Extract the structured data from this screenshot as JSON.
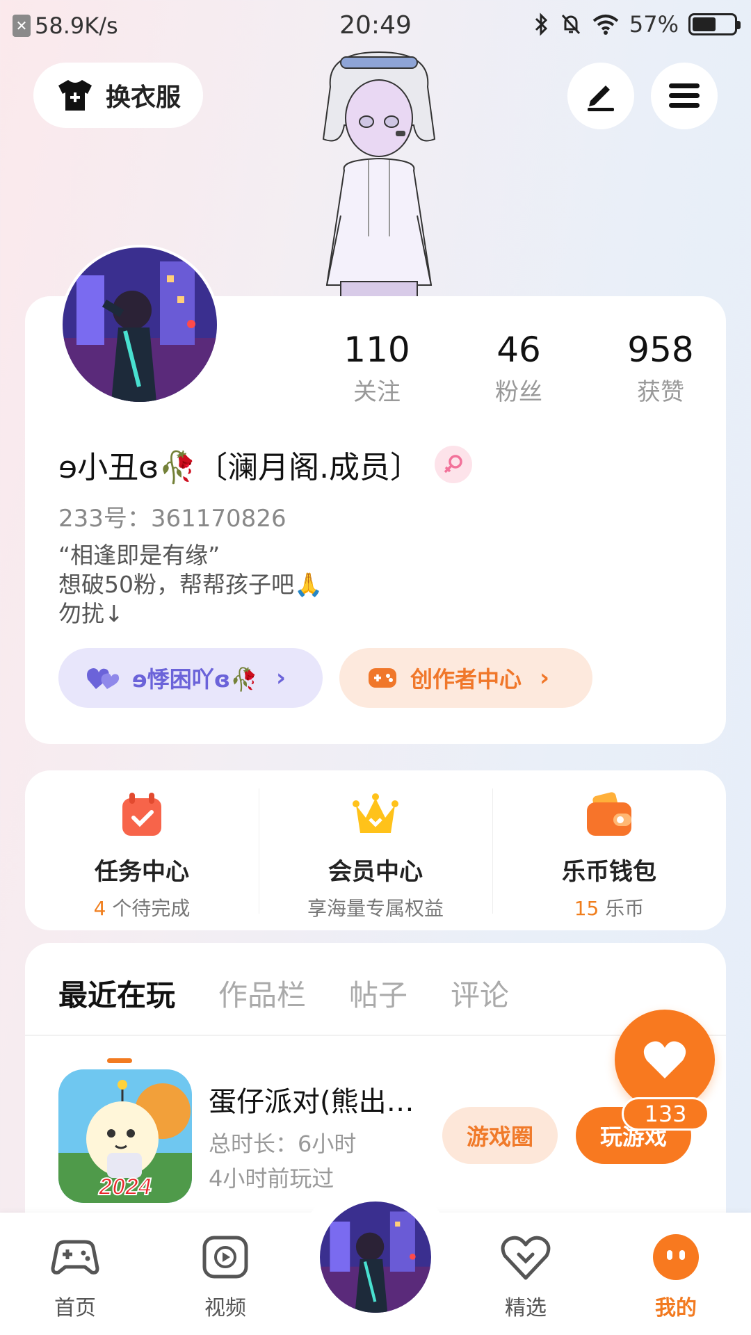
{
  "status_bar": {
    "net_speed": "58.9K/s",
    "time": "20:49",
    "battery_pct": "57%",
    "battery_level": 0.57
  },
  "top": {
    "dress_label": "换衣服"
  },
  "profile": {
    "stats": [
      {
        "num": "110",
        "label": "关注"
      },
      {
        "num": "46",
        "label": "粉丝"
      },
      {
        "num": "958",
        "label": "获赞"
      }
    ],
    "nickname": "ɘ小丑ɞ🥀〔澜月阁.成员〕",
    "uid": "233号：361170826",
    "bio": "“相逢即是有缘”\n想破50粉，帮帮孩子吧🙏\n勿扰↓",
    "guild_chip": "ɘ悸困吖ɞ🥀",
    "creator_chip": "创作者中心"
  },
  "services": [
    {
      "title": "任务中心",
      "sub_hl": "4",
      "sub": " 个待完成"
    },
    {
      "title": "会员中心",
      "sub_hl": "",
      "sub": "享海量专属权益"
    },
    {
      "title": "乐币钱包",
      "sub_hl": "15",
      "sub": " 乐币"
    }
  ],
  "tabs": [
    "最近在玩",
    "作品栏",
    "帖子",
    "评论"
  ],
  "recent_game": {
    "title": "蛋仔派对(熊出…",
    "duration": "总时长：6小时",
    "last_played": "4小时前玩过",
    "circle_btn": "游戏圈",
    "play_btn": "玩游戏",
    "badge": "2024"
  },
  "like_count": "133",
  "nav": [
    {
      "label": "首页"
    },
    {
      "label": "视频"
    },
    {
      "label": "精选"
    },
    {
      "label": "我的"
    }
  ],
  "colors": {
    "accent": "#f27a20",
    "guild": "#6b63d9"
  }
}
